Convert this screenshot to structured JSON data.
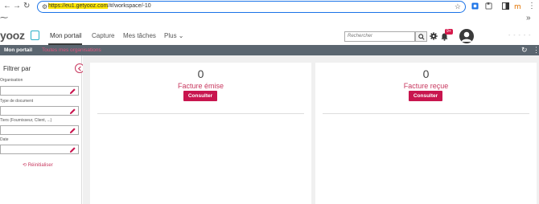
{
  "browser": {
    "url_highlight": "https://eu1.getyooz.com",
    "url_rest": "/#/workspace/-10",
    "icons": [
      "back-icon",
      "forward-icon",
      "reload-icon",
      "site-info-icon",
      "star-icon",
      "extensions-icon"
    ]
  },
  "app": {
    "logo_text": "yooz",
    "tabs": [
      {
        "label": "Mon portail",
        "active": true
      },
      {
        "label": "Capture",
        "active": false
      },
      {
        "label": "Mes tâches",
        "active": false
      },
      {
        "label": "Plus",
        "active": false
      }
    ],
    "search_placeholder": "Rechercher",
    "notification_badge": "9+",
    "user_name": "- - - - -"
  },
  "subbar": {
    "title": "Mon portail",
    "org_label": "Toutes mes organisations"
  },
  "sidebar": {
    "title": "Filtrer par",
    "filters": [
      {
        "label": "Organisation"
      },
      {
        "label": "Type de document"
      },
      {
        "label": "Tiers (Fournisseur, Client, ...)"
      },
      {
        "label": "Date"
      }
    ],
    "reset_label": "Réinitialiser"
  },
  "cards": [
    {
      "count": "0",
      "title": "Facture émise",
      "button": "Consulter"
    },
    {
      "count": "0",
      "title": "Facture reçue",
      "button": "Consulter"
    }
  ],
  "colors": {
    "accent": "#c8154e",
    "bar": "#5b6670",
    "url_highlight": "#ffe800"
  }
}
